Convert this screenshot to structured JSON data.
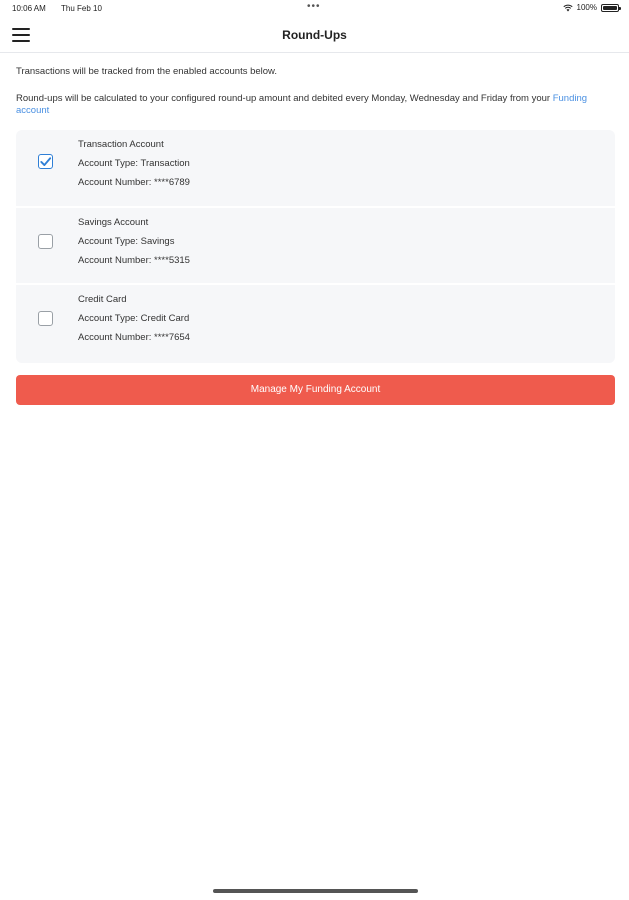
{
  "status_bar": {
    "time": "10:06 AM",
    "date": "Thu Feb 10",
    "dots": "•••",
    "battery_label": "100%"
  },
  "nav": {
    "title": "Round-Ups",
    "menu_icon": "hamburger-menu-icon"
  },
  "intro": {
    "line1": "Transactions will be tracked from the enabled accounts below.",
    "line2_prefix": "Round-ups will be calculated to your configured round-up amount and debited every Monday, Wednesday and Friday from your ",
    "line2_link": "Funding account"
  },
  "accounts": [
    {
      "name": "Transaction Account",
      "type": "Account Type: Transaction",
      "number": "Account Number: ****6789",
      "checked": true
    },
    {
      "name": "Savings Account",
      "type": "Account Type: Savings",
      "number": "Account Number: ****5315",
      "checked": false
    },
    {
      "name": "Credit Card",
      "type": "Account Type: Credit Card",
      "number": "Account Number: ****7654",
      "checked": false
    }
  ],
  "manage_button": {
    "label": "Manage My Funding Account"
  },
  "colors": {
    "accent_blue": "#2f7fd6",
    "link_blue": "#4a90e2",
    "button_red": "#ef5b4d",
    "card_bg": "#f6f7f9"
  }
}
